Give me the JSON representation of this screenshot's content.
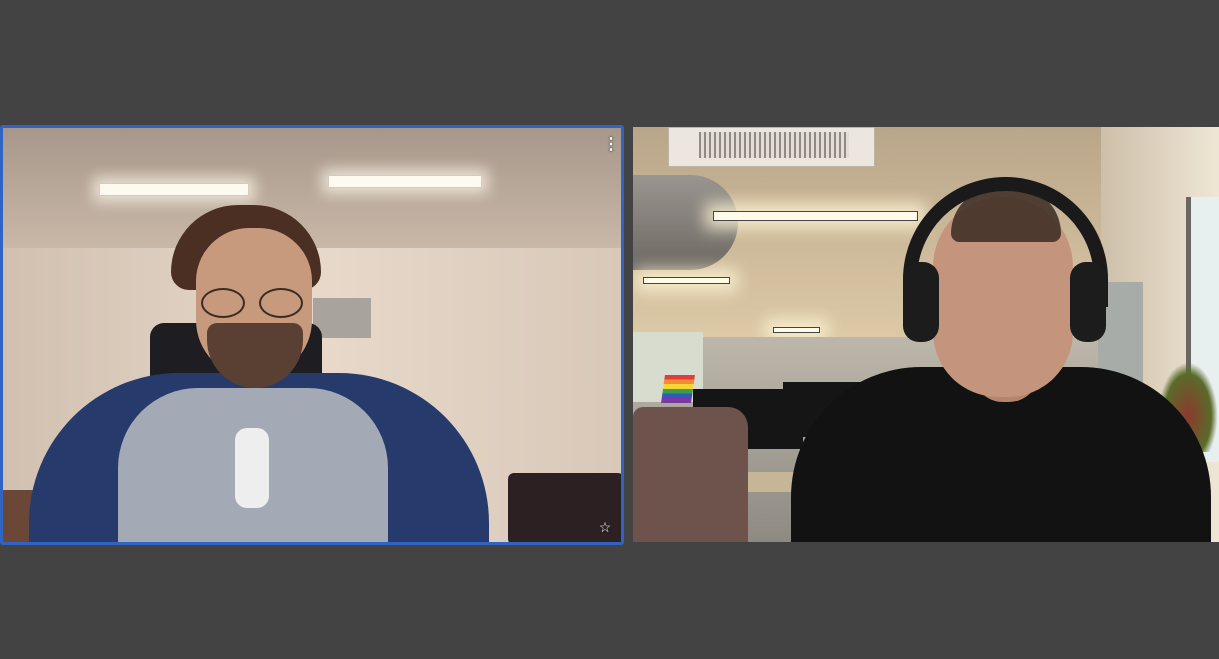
{
  "window": {
    "background_color": "#434343"
  },
  "participants": [
    {
      "id": "left",
      "active_speaker": true,
      "highlight_color": "#2f64c4",
      "controls": {
        "more_options_icon": "more-vertical-icon",
        "more_options_glyph": "⋮",
        "pin_icon": "star-outline-icon",
        "pin_glyph": "☆"
      }
    },
    {
      "id": "right",
      "active_speaker": false,
      "highlight_color": ""
    }
  ]
}
